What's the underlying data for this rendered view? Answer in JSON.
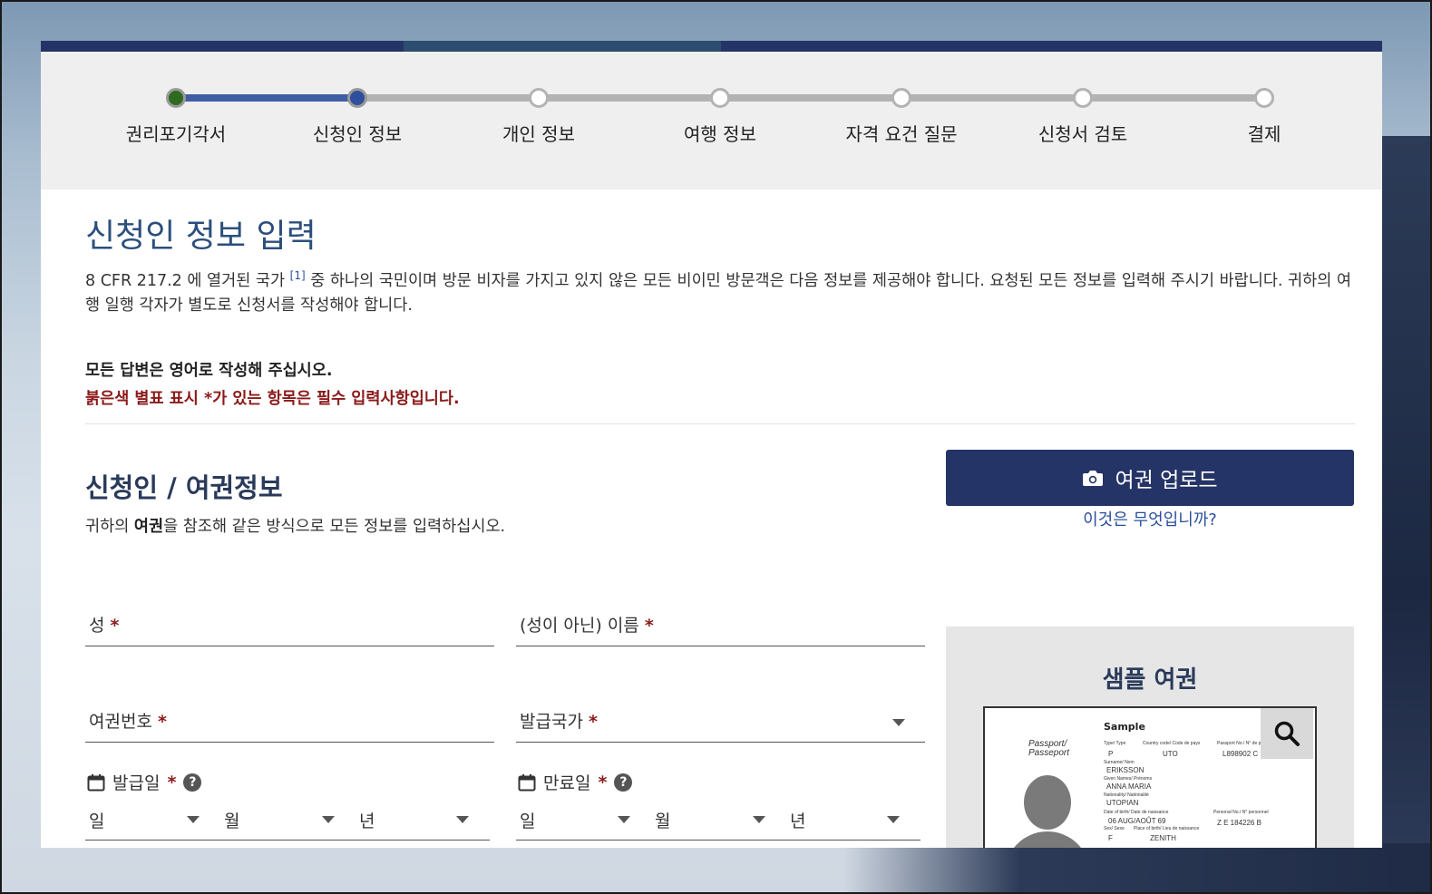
{
  "steps": [
    {
      "label": "권리포기각서",
      "state": "done"
    },
    {
      "label": "신청인 정보",
      "state": "current"
    },
    {
      "label": "개인 정보",
      "state": "todo"
    },
    {
      "label": "여행 정보",
      "state": "todo"
    },
    {
      "label": "자격 요건 질문",
      "state": "todo"
    },
    {
      "label": "신청서 검토",
      "state": "todo"
    },
    {
      "label": "결제",
      "state": "todo"
    }
  ],
  "page": {
    "title": "신청인 정보 입력",
    "intro_before_sup": "8 CFR 217.2 에 열거된 국가 ",
    "intro_sup": "[1]",
    "intro_after_sup": " 중 하나의 국민이며 방문 비자를 가지고 있지 않은 모든 비이민 방문객은 다음 정보를 제공해야 합니다. 요청된 모든 정보를 입력해 주시기 바랍니다. 귀하의 여행 일행 각자가 별도로 신청서를 작성해야 합니다.",
    "note_english": "모든 답변은 영어로 작성해 주십시오.",
    "note_required": "붉은색 별표 표시 *가 있는 항목은 필수 입력사항입니다."
  },
  "section": {
    "title": "신청인 / 여권정보",
    "sub_before": "귀하의 ",
    "sub_bold": "여권",
    "sub_after": "을 참조해 같은 방식으로 모든 정보를 입력하십시오."
  },
  "upload": {
    "label": "여권 업로드",
    "what": "이것은 무엇입니까?",
    "icon": "camera-icon"
  },
  "fields": {
    "surname": "성",
    "given_name": "(성이 아닌) 이름",
    "passport_no": "여권번호",
    "issuing_country": "발급국가",
    "issue_date": "발급일",
    "expiry_date": "만료일",
    "required_mark": "*",
    "help_mark": "?",
    "day": "일",
    "month": "월",
    "year": "년"
  },
  "sample": {
    "title": "샘플 여권",
    "word": "Sample",
    "passport_label": "Passport/",
    "passport_label2": "Passeport",
    "type_label": "Type/ Type",
    "type": "P",
    "country_label": "Country code/ Code de pays",
    "country": "UTO",
    "pno_label": "Passport No./ N° de passeport",
    "pno": "L898902 C",
    "surname_label": "Surname/ Nom",
    "surname": "ERIKSSON",
    "given_label": "Given Names/ Prénoms",
    "given": "ANNA MARIA",
    "nat_label": "Nationality/ Nationalité",
    "nat": "UTOPIAN",
    "dob_label": "Date of birth/ Date de naissance",
    "dob": "06 AUG/AOÛT 69",
    "pers_label": "Personal No./ N° personnel",
    "pers": "Z E 184226 B",
    "sex_label": "Sex/ Sexe",
    "sex": "F",
    "pob_label": "Place of birth/ Lieu de naissance",
    "pob": "ZENITH"
  }
}
